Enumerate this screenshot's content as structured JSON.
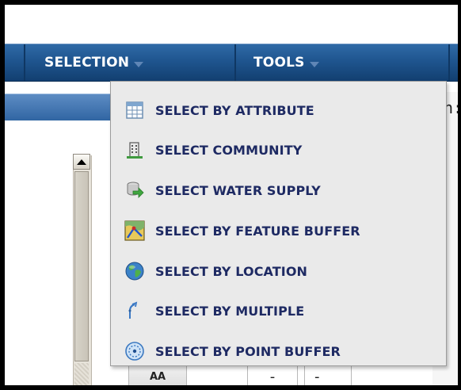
{
  "menubar": {
    "items": [
      {
        "label": "SELECTION",
        "icon": "chevron-down-icon"
      },
      {
        "label": "TOOLS",
        "icon": "chevron-down-icon"
      }
    ]
  },
  "dropdown": {
    "items": [
      {
        "label": "SELECT BY ATTRIBUTE",
        "icon": "table-icon"
      },
      {
        "label": "SELECT COMMUNITY",
        "icon": "building-icon"
      },
      {
        "label": "SELECT WATER SUPPLY",
        "icon": "water-supply-icon"
      },
      {
        "label": "SELECT BY FEATURE BUFFER",
        "icon": "map-buffer-icon"
      },
      {
        "label": "SELECT BY LOCATION",
        "icon": "globe-icon"
      },
      {
        "label": "SELECT BY MULTIPLE",
        "icon": "cursor-multiple-icon"
      },
      {
        "label": "SELECT BY POINT BUFFER",
        "icon": "point-buffer-icon"
      }
    ]
  },
  "background": {
    "right_text": "n:",
    "cell_a": "AA",
    "cell_b": "-",
    "cell_c": "-"
  },
  "colors": {
    "menubar": "#1f558f",
    "menu_text": "#ffffff",
    "dropdown_bg": "#eaeaea",
    "dropdown_text": "#1e2a63"
  }
}
